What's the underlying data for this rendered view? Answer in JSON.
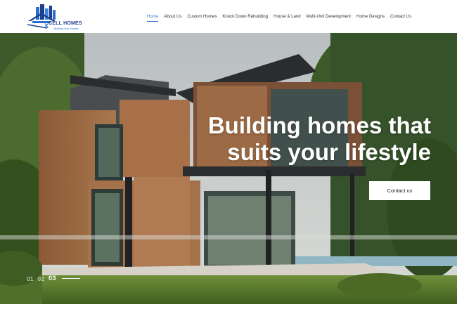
{
  "brand": {
    "name": "CELL HOMES",
    "tagline": "Building Your Dreams"
  },
  "nav": {
    "items": [
      {
        "label": "Home",
        "active": true
      },
      {
        "label": "About Us",
        "active": false
      },
      {
        "label": "Custom Homes",
        "active": false
      },
      {
        "label": "Knock Down Rebuilding",
        "active": false
      },
      {
        "label": "House & Land",
        "active": false
      },
      {
        "label": "Multi-Unit Development",
        "active": false
      },
      {
        "label": "Home Designs",
        "active": false
      },
      {
        "label": "Contact Us",
        "active": false
      }
    ]
  },
  "hero": {
    "title_line1": "Building homes that",
    "title_line2": "suits your lifestyle",
    "cta_label": "Contact us",
    "slides": [
      "01",
      "02",
      "03"
    ],
    "active_slide": "03"
  },
  "colors": {
    "accent": "#2f7bd6",
    "brand_navy": "#1c3f8f"
  },
  "icons": {
    "logo": "house-city-skyline-logo"
  }
}
